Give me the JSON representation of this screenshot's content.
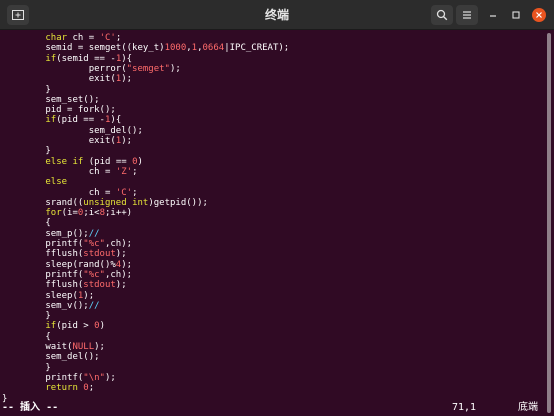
{
  "window": {
    "title": "终端",
    "new_tab_icon": "new-tab-icon",
    "search_icon": "search-icon",
    "menu_icon": "hamburger-menu-icon",
    "minimize_icon": "minimize-icon",
    "maximize_icon": "maximize-icon",
    "close_icon": "close-icon",
    "close_color": "#e95420"
  },
  "terminal": {
    "background": "#300a24",
    "lines": [
      "        char ch = 'C';",
      "        semid = semget((key_t)1000,1,0664|IPC_CREAT);",
      "        if(semid == -1){",
      "                perror(\"semget\");",
      "                exit(1);",
      "        }",
      "        sem_set();",
      "        pid = fork();",
      "        if(pid == -1){",
      "                sem_del();",
      "                exit(1);",
      "        }",
      "        else if (pid == 0)",
      "                ch = 'Z';",
      "        else",
      "                ch = 'C';",
      "        srand((unsigned int)getpid());",
      "        for(i=0;i<8;i++)",
      "        {",
      "        sem_p();//",
      "        printf(\"%c\",ch);",
      "        fflush(stdout);",
      "        sleep(rand()%4);",
      "        printf(\"%c\",ch);",
      "        fflush(stdout);",
      "        sleep(1);",
      "        sem_v();//",
      "        }",
      "        if(pid > 0)",
      "        {",
      "        wait(NULL);",
      "        sem_del();",
      "        }",
      "        printf(\"\\n\");",
      "        return 0;",
      "}"
    ]
  },
  "status": {
    "mode": "-- 插入 --",
    "position": "71,1",
    "scroll": "底端"
  }
}
